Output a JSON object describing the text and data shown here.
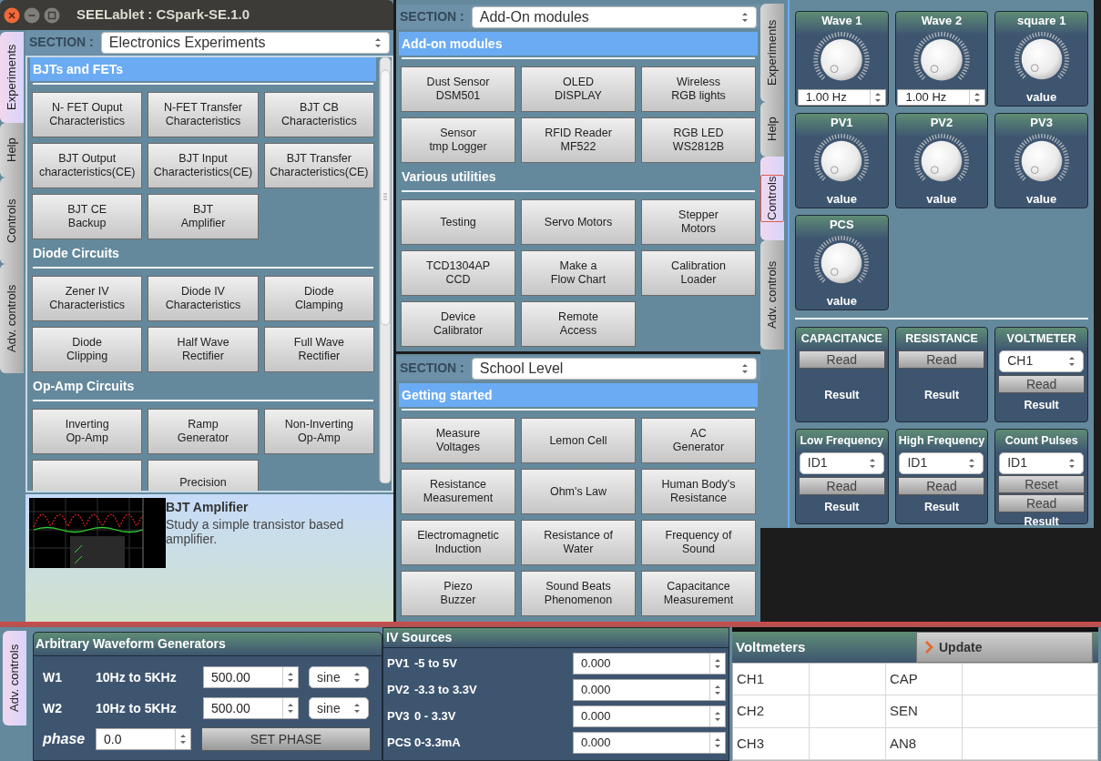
{
  "experiments_window": {
    "title": "SEELablet : CSpark-SE.1.0",
    "tabs": [
      {
        "label": "Experiments",
        "selected": true
      },
      {
        "label": "Help",
        "selected": false
      },
      {
        "label": "Controls",
        "selected": false
      },
      {
        "label": "Adv. controls",
        "selected": false
      }
    ],
    "section_label": "SECTION :",
    "section_value": "Electronics Experiments",
    "groups": [
      {
        "heading": "BJTs and FETs",
        "highlighted": true,
        "buttons": [
          "N- FET Ouput\nCharacteristics",
          "N-FET Transfer\nCharacteristics",
          "BJT CB\nCharacteristics",
          "BJT Output\ncharacteristics(CE)",
          "BJT Input\nCharacteristics(CE)",
          "BJT Transfer\nCharacteristics(CE)",
          "BJT CE\nBackup",
          "BJT\nAmplifier"
        ]
      },
      {
        "heading": "Diode Circuits",
        "highlighted": false,
        "buttons": [
          "Zener IV\nCharacteristics",
          "Diode IV\nCharacteristics",
          "Diode\nClamping",
          "Diode\nClipping",
          "Half Wave\nRectifier",
          "Full Wave\nRectifier"
        ]
      },
      {
        "heading": "Op-Amp Circuits",
        "highlighted": false,
        "buttons": [
          "Inverting\nOp-Amp",
          "Ramp\nGenerator",
          "Non-Inverting\nOp-Amp",
          {
            "kind": "blank"
          },
          "Precision"
        ]
      }
    ],
    "help": {
      "title": "BJT Amplifier",
      "text": "Study a simple transistor based amplifier."
    }
  },
  "addons_panel": {
    "section_label": "SECTION :",
    "section_value": "Add-On modules",
    "groups": [
      {
        "heading": "Add-on modules",
        "highlighted": true,
        "buttons": [
          "Dust Sensor\nDSM501",
          "OLED\nDISPLAY",
          "Wireless\nRGB lights",
          "Sensor\ntmp Logger",
          "RFID Reader\nMF522",
          "RGB LED\nWS2812B"
        ]
      },
      {
        "heading": "Various utilities",
        "highlighted": false,
        "buttons": [
          "Testing",
          "Servo Motors",
          "Stepper\nMotors",
          "TCD1304AP\nCCD",
          "Make a\nFlow Chart",
          "Calibration\nLoader",
          "Device\nCalibrator",
          "Remote\nAccess"
        ]
      }
    ]
  },
  "school_panel": {
    "section_label": "SECTION :",
    "section_value": "School Level",
    "groups": [
      {
        "heading": "Getting started",
        "highlighted": true,
        "buttons": [
          "Measure\nVoltages",
          "Lemon Cell",
          "AC\nGenerator",
          "Resistance\nMeasurement",
          "Ohm's Law",
          "Human Body's\nResistance",
          "Electromagnetic\nInduction",
          "Resistance of\nWater",
          "Frequency of\nSound",
          "Piezo\nBuzzer",
          "Sound Beats\nPhenomenon",
          "Capacitance\nMeasurement"
        ]
      }
    ]
  },
  "controls_window": {
    "tabs": [
      {
        "label": "Experiments",
        "selected": false
      },
      {
        "label": "Help",
        "selected": false
      },
      {
        "label": "Controls",
        "selected": true
      },
      {
        "label": "Adv. controls",
        "selected": false
      }
    ],
    "knobs": [
      {
        "title": "Wave 1",
        "kind": "spinbox",
        "display": "1.00 Hz"
      },
      {
        "title": "Wave 2",
        "kind": "spinbox",
        "display": "1.00 Hz"
      },
      {
        "title": "square 1",
        "kind": "readout",
        "display": "value"
      },
      {
        "title": "PV1",
        "kind": "readout",
        "display": "value"
      },
      {
        "title": "PV2",
        "kind": "readout",
        "display": "value"
      },
      {
        "title": "PV3",
        "kind": "readout",
        "display": "value"
      },
      {
        "title": "PCS",
        "kind": "readout",
        "display": "value"
      }
    ],
    "meters": [
      {
        "title": "CAPACITANCE",
        "buttons": [
          "Read"
        ],
        "result": "Result"
      },
      {
        "title": "RESISTANCE",
        "buttons": [
          "Read"
        ],
        "result": "Result"
      },
      {
        "title": "VOLTMETER",
        "select": "CH1",
        "buttons": [
          "Read"
        ],
        "result": "Result"
      },
      {
        "title": "Low Frequency",
        "select": "ID1",
        "buttons": [
          "Read"
        ],
        "result": "Result"
      },
      {
        "title": "High Frequency",
        "select": "ID1",
        "buttons": [
          "Read"
        ],
        "result": "Result"
      },
      {
        "title": "Count Pulses",
        "select": "ID1",
        "buttons": [
          "Reset",
          "Read"
        ],
        "result": "Result"
      }
    ]
  },
  "adv_window": {
    "tabs": [
      {
        "label": "Adv. controls",
        "selected": true
      }
    ],
    "awg": {
      "title": "Arbitrary Waveform Generators",
      "rows": [
        {
          "name": "W1",
          "range": "10Hz to 5KHz",
          "value": "500.00",
          "shape": "sine"
        },
        {
          "name": "W2",
          "range": "10Hz to 5KHz",
          "value": "500.00",
          "shape": "sine"
        }
      ],
      "phase_label": "phase",
      "phase_value": "0.0",
      "set_phase": "SET PHASE"
    },
    "iv": {
      "title": "IV Sources",
      "rows": [
        {
          "name": "PV1",
          "range": "-5 to 5V",
          "value": "0.000"
        },
        {
          "name": "PV2",
          "range": "-3.3 to 3.3V",
          "value": "0.000"
        },
        {
          "name": "PV3",
          "range": "0 - 3.3V",
          "value": "0.000"
        },
        {
          "name": "PCS",
          "range": "0-3.3mA",
          "value": "0.000"
        }
      ]
    },
    "voltmeters": {
      "title": "Voltmeters",
      "update": "Update",
      "rows": [
        {
          "channel": "CH1",
          "channel_2": "CAP"
        },
        {
          "channel": "CH2",
          "channel_2": "SEN"
        },
        {
          "channel": "CH3",
          "channel_2": "AN8"
        }
      ]
    }
  }
}
